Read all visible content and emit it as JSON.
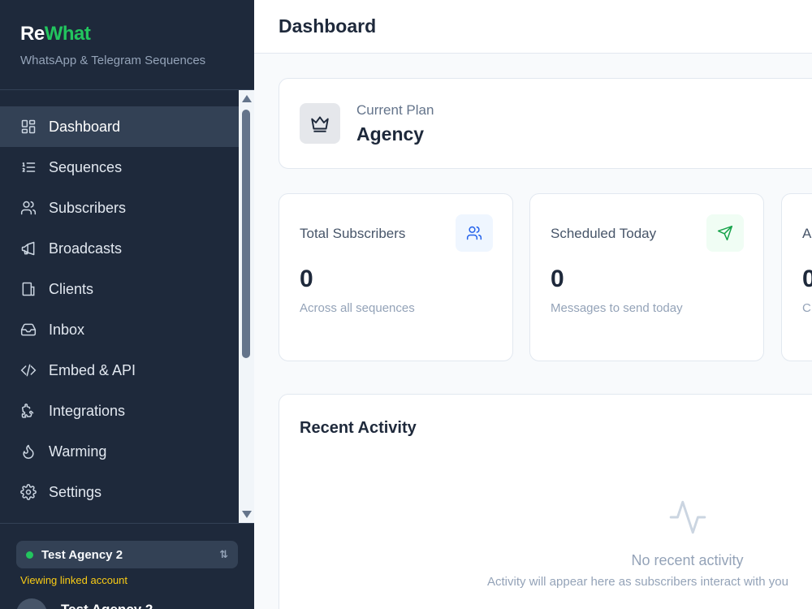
{
  "brand": {
    "name_part1": "Re",
    "name_part2": "What",
    "tagline": "WhatsApp & Telegram Sequences"
  },
  "sidebar": {
    "items": [
      {
        "label": "Dashboard",
        "icon": "dashboard-grid-icon",
        "active": true
      },
      {
        "label": "Sequences",
        "icon": "list-ordered-icon"
      },
      {
        "label": "Subscribers",
        "icon": "users-icon"
      },
      {
        "label": "Broadcasts",
        "icon": "megaphone-icon"
      },
      {
        "label": "Clients",
        "icon": "building-icon"
      },
      {
        "label": "Inbox",
        "icon": "inbox-icon"
      },
      {
        "label": "Embed & API",
        "icon": "code-icon"
      },
      {
        "label": "Integrations",
        "icon": "puzzle-icon"
      },
      {
        "label": "Warming",
        "icon": "flame-icon"
      },
      {
        "label": "Settings",
        "icon": "gear-icon"
      }
    ],
    "account": {
      "name": "Test Agency 2",
      "status_color": "#22c55e",
      "linked_note": "Viewing linked account"
    },
    "user": {
      "name": "Test Agency 2"
    }
  },
  "header": {
    "title": "Dashboard"
  },
  "plan": {
    "label": "Current Plan",
    "value": "Agency",
    "icon": "crown-icon"
  },
  "stats": [
    {
      "title": "Total Subscribers",
      "value": "0",
      "sub": "Across all sequences",
      "icon": "users-icon",
      "icon_bg": "#eff6ff",
      "icon_color": "#2563eb"
    },
    {
      "title": "Scheduled Today",
      "value": "0",
      "sub": "Messages to send today",
      "icon": "send-icon",
      "icon_bg": "#f0fdf4",
      "icon_color": "#16a34a"
    },
    {
      "title": "A",
      "value": "0",
      "sub": "C"
    }
  ],
  "activity": {
    "title": "Recent Activity",
    "empty_title": "No recent activity",
    "empty_sub": "Activity will appear here as subscribers interact with you",
    "icon": "activity-pulse-icon"
  },
  "colors": {
    "sidebar_bg": "#1e293b",
    "accent_green": "#22c55e",
    "page_bg": "#f8fafc"
  }
}
